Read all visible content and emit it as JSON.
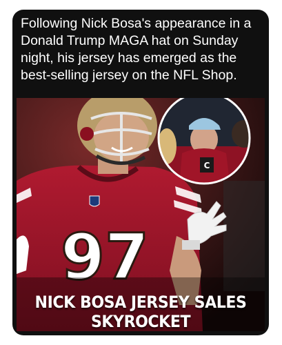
{
  "post": {
    "caption": "Following Nick Bosa's appearance in a Donald Trump MAGA hat on Sunday night, his jersey has emerged as the best-selling jersey on the NFL Shop."
  },
  "image": {
    "headline_line1": "NICK BOSA JERSEY SALES",
    "headline_line2": "SKYROCKET",
    "jersey_number": "97",
    "mic_label": "C"
  },
  "colors": {
    "jersey_red": "#a3152a",
    "helmet_gold": "#b89d6a",
    "card_bg": "#101010"
  }
}
